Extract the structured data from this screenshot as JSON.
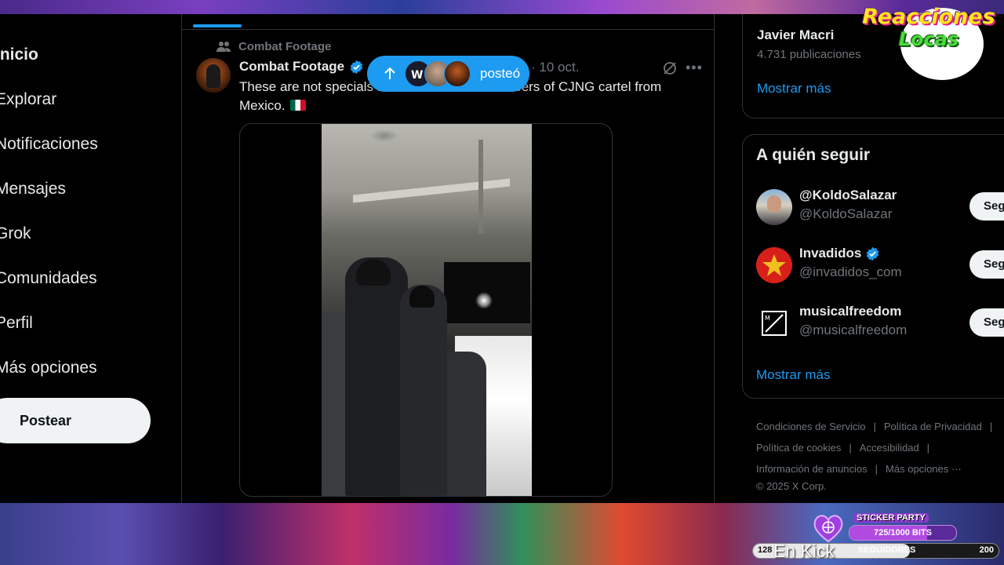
{
  "nav": {
    "items": [
      {
        "label": "Inicio",
        "bold": true
      },
      {
        "label": "Explorar"
      },
      {
        "label": "Notificaciones"
      },
      {
        "label": "Mensajes"
      },
      {
        "label": "Grok"
      },
      {
        "label": "Comunidades"
      },
      {
        "label": "Perfil"
      },
      {
        "label": "Más opciones"
      }
    ],
    "post_button": "Postear"
  },
  "tweet": {
    "repost_context": "Combat Footage",
    "author": "Combat Footage",
    "date": "· 10 oct.",
    "text": "These are not specials forces. These are members of CJNG cartel from Mexico.",
    "repost_pill_label": "posteó"
  },
  "right": {
    "trend_card": {
      "name": "Javier Macri",
      "count": "4.731 publicaciones",
      "show_more": "Mostrar más"
    },
    "who_to_follow": {
      "title": "A quién seguir",
      "users": [
        {
          "name": "@KoldoSalazar",
          "handle": "@KoldoSalazar",
          "verified": false,
          "button": "Seg"
        },
        {
          "name": "Invadidos",
          "handle": "@invadidos_com",
          "verified": true,
          "button": "Seg"
        },
        {
          "name": "musicalfreedom",
          "handle": "@musicalfreedom",
          "verified": false,
          "button": "Seg"
        }
      ],
      "show_more": "Mostrar más"
    },
    "footer": {
      "links": [
        "Condiciones de Servicio",
        "Política de Privacidad",
        "Política de cookies",
        "Accesibilidad",
        "Información de anuncios",
        "Más opciones ···"
      ],
      "copyright": "© 2025 X Corp."
    }
  },
  "overlay": {
    "logo_line1": "Reacciones",
    "logo_line2": "Locas",
    "sticker_title": "STICKER PARTY",
    "sticker_bits": "725/1000 BITS",
    "sticker_progress": 0.725,
    "followers_current": "128",
    "followers_label": "SEGUIDORES",
    "followers_goal": "200",
    "followers_progress": 0.64,
    "kick_text": "En Kick"
  },
  "colors": {
    "accent": "#1d9bf0",
    "text_primary": "#e7e9ea",
    "text_secondary": "#71767b",
    "border": "#2f3336"
  }
}
